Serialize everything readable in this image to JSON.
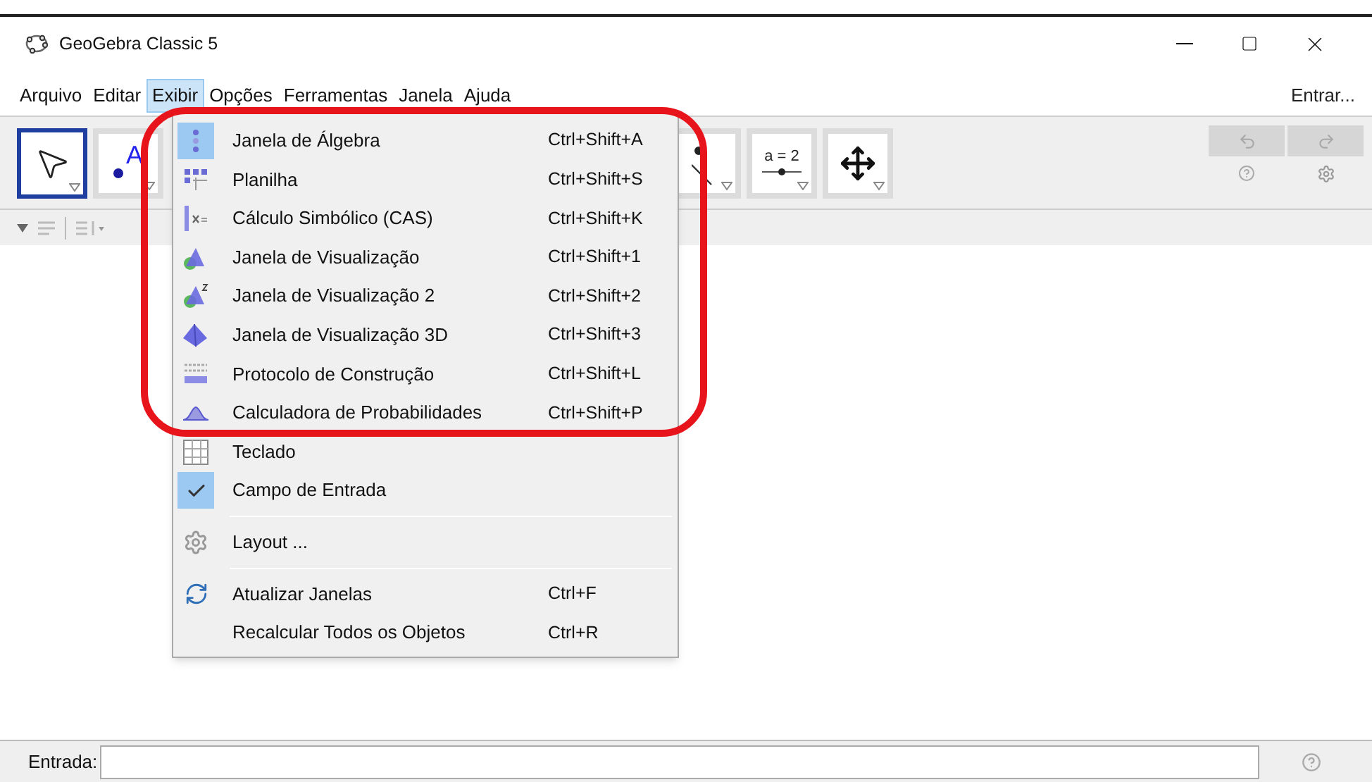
{
  "window": {
    "title": "GeoGebra Classic 5"
  },
  "menubar": {
    "items": [
      {
        "label": "Arquivo",
        "selected": false
      },
      {
        "label": "Editar",
        "selected": false
      },
      {
        "label": "Exibir",
        "selected": true
      },
      {
        "label": "Opções",
        "selected": false
      },
      {
        "label": "Ferramentas",
        "selected": false
      },
      {
        "label": "Janela",
        "selected": false
      },
      {
        "label": "Ajuda",
        "selected": false
      }
    ],
    "login": "Entrar..."
  },
  "toolbar": {
    "tools": [
      {
        "kind": "move",
        "selected": true
      },
      {
        "kind": "point",
        "label": "A",
        "selected": false
      },
      {
        "kind": "line",
        "selected": false
      },
      {
        "kind": "slider",
        "label": "a = 2",
        "selected": false
      },
      {
        "kind": "pan",
        "selected": false
      }
    ],
    "undo_disabled": true,
    "redo_disabled": true
  },
  "menu": {
    "items": [
      {
        "kind": "item",
        "label": "Janela de Álgebra",
        "shortcut": "Ctrl+Shift+A",
        "checked": true
      },
      {
        "kind": "item",
        "label": "Planilha",
        "shortcut": "Ctrl+Shift+S",
        "checked": false
      },
      {
        "kind": "item",
        "label": "Cálculo Simbólico (CAS)",
        "shortcut": "Ctrl+Shift+K",
        "checked": false
      },
      {
        "kind": "item",
        "label": "Janela de Visualização",
        "shortcut": "Ctrl+Shift+1",
        "checked": false
      },
      {
        "kind": "item",
        "label": "Janela de Visualização 2",
        "shortcut": "Ctrl+Shift+2",
        "checked": false
      },
      {
        "kind": "item",
        "label": "Janela de Visualização 3D",
        "shortcut": "Ctrl+Shift+3",
        "checked": false
      },
      {
        "kind": "item",
        "label": "Protocolo de Construção",
        "shortcut": "Ctrl+Shift+L",
        "checked": false
      },
      {
        "kind": "item",
        "label": "Calculadora de Probabilidades",
        "shortcut": "Ctrl+Shift+P",
        "checked": false
      },
      {
        "kind": "item",
        "label": "Teclado",
        "checked": false
      },
      {
        "kind": "item",
        "label": "Campo de Entrada",
        "checked": true
      },
      {
        "kind": "separator"
      },
      {
        "kind": "item",
        "label": "Layout ...",
        "checked": false
      },
      {
        "kind": "separator"
      },
      {
        "kind": "item",
        "label": "Atualizar Janelas",
        "shortcut": "Ctrl+F",
        "checked": false
      },
      {
        "kind": "item",
        "label": "Recalcular Todos os Objetos",
        "shortcut": "Ctrl+R",
        "checked": false
      }
    ]
  },
  "input_bar": {
    "label": "Entrada:"
  }
}
